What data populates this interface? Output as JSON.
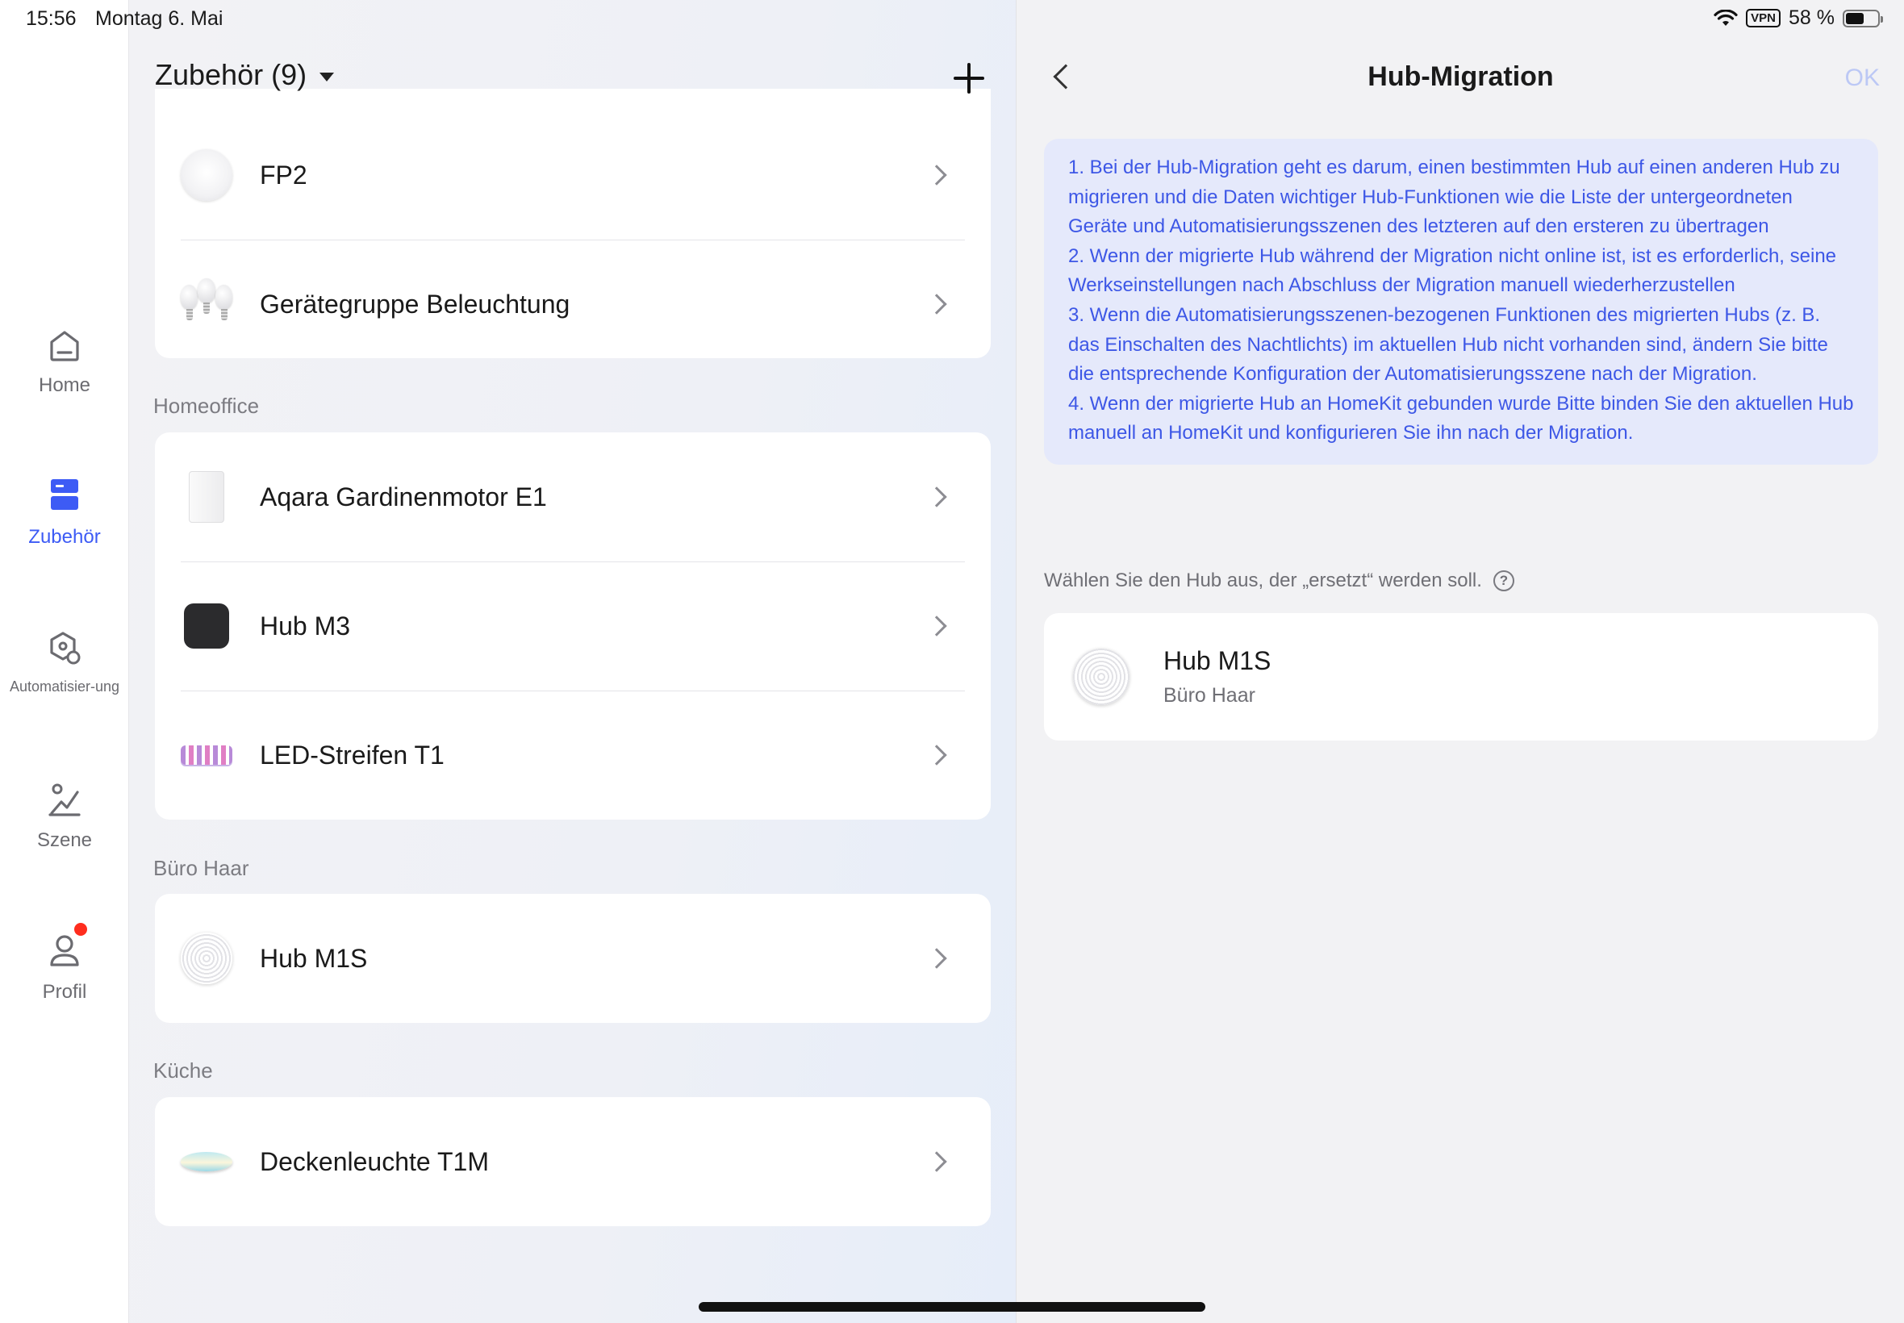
{
  "status_bar": {
    "time": "15:56",
    "date": "Montag 6. Mai",
    "vpn": "VPN",
    "battery": "58 %",
    "battery_level": 0.58
  },
  "sidebar": {
    "items": [
      {
        "label": "Home",
        "icon": "home-icon",
        "active": false
      },
      {
        "label": "Zubehör",
        "icon": "accessories-icon",
        "active": true
      },
      {
        "label": "Automatisier-ung",
        "icon": "automation-icon",
        "active": false
      },
      {
        "label": "Szene",
        "icon": "scene-icon",
        "active": false
      },
      {
        "label": "Profil",
        "icon": "profile-icon",
        "active": false,
        "badge": true
      }
    ]
  },
  "list": {
    "title": "Zubehör (9)",
    "groups": [
      {
        "name": "",
        "items": [
          "FP2",
          "Gerätegruppe Beleuchtung"
        ]
      },
      {
        "name": "Homeoffice",
        "items": [
          "Aqara Gardinenmotor E1",
          "Hub M3",
          "LED-Streifen T1"
        ]
      },
      {
        "name": "Büro Haar",
        "items": [
          "Hub M1S"
        ]
      },
      {
        "name": "Küche",
        "items": [
          "Deckenleuchte T1M"
        ]
      }
    ]
  },
  "detail": {
    "title": "Hub-Migration",
    "ok_label": "OK",
    "info": [
      "1. Bei der Hub-Migration geht es darum, einen bestimmten Hub auf einen anderen Hub zu migrieren und die Daten wichtiger Hub-Funktionen wie die Liste der untergeordneten Geräte und Automatisierungsszenen des letzteren auf den ersteren zu übertragen",
      "2. Wenn der migrierte Hub während der Migration nicht online ist, ist es erforderlich, seine Werkseinstellungen nach Abschluss der Migration manuell wiederherzustellen",
      "3. Wenn die Automatisierungsszenen-bezogenen Funktionen des migrierten Hubs (z. B. das Einschalten des Nachtlichts) im aktuellen Hub nicht vorhanden sind, ändern Sie bitte die entsprechende Konfiguration der Automatisierungsszene nach der Migration.",
      "4. Wenn der migrierte Hub an HomeKit gebunden wurde Bitte binden Sie den aktuellen Hub manuell an HomeKit und konfigurieren Sie ihn nach der Migration."
    ],
    "pick_label": "Wählen Sie den Hub aus, der „ersetzt“ werden soll.",
    "help_icon": "?",
    "hub": {
      "name": "Hub M1S",
      "room": "Büro Haar"
    }
  },
  "colors": {
    "accent": "#3d5bf5",
    "info_bg": "#e5e9fb",
    "info_text": "#3d57e6",
    "badge": "#ff2d1e"
  }
}
